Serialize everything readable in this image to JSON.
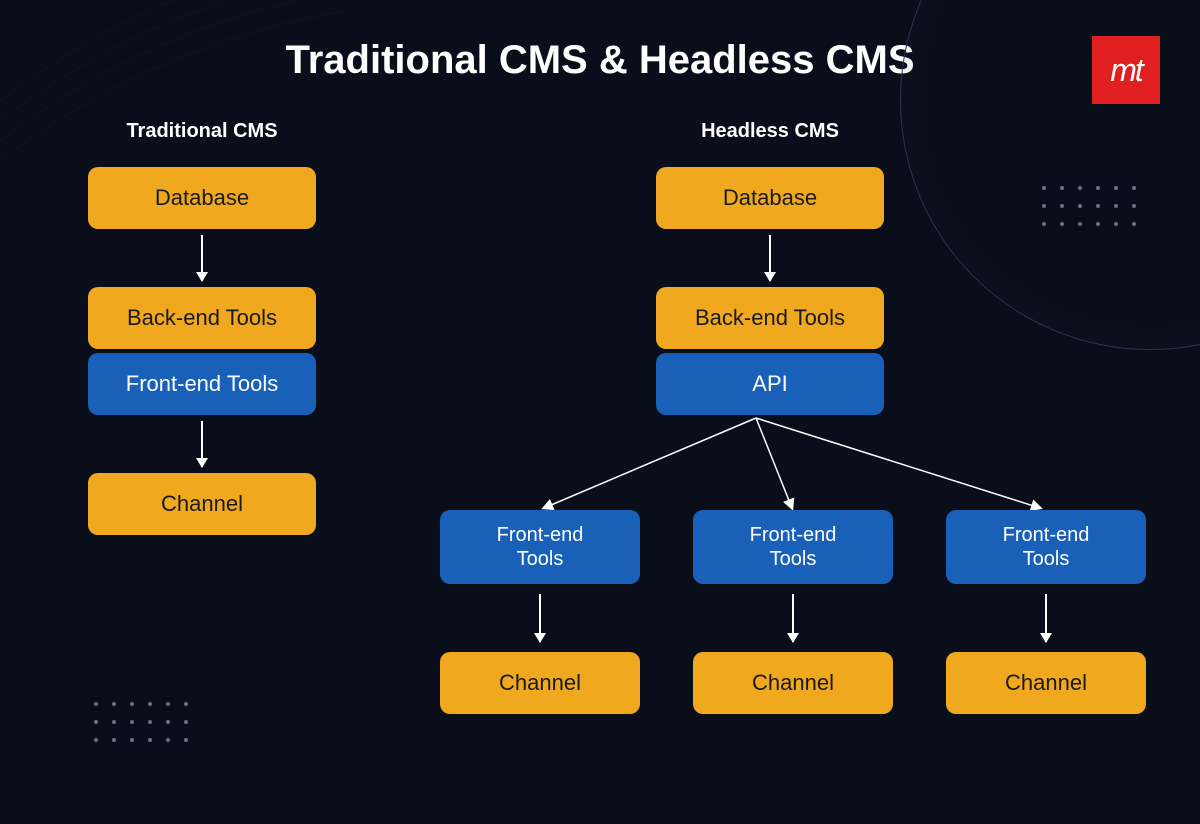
{
  "title": "Traditional CMS & Headless CMS",
  "logo": {
    "text": "mt"
  },
  "colors": {
    "orange": "#f0a81e",
    "blue": "#1860b8",
    "red": "#e02020",
    "bg": "#0a0e1a"
  },
  "traditional": {
    "title": "Traditional CMS",
    "database": "Database",
    "backend": "Back-end Tools",
    "frontend": "Front-end Tools",
    "channel": "Channel"
  },
  "headless": {
    "title": "Headless CMS",
    "database": "Database",
    "backend": "Back-end Tools",
    "api": "API",
    "branches": [
      {
        "frontend": "Front-end\nTools",
        "channel": "Channel"
      },
      {
        "frontend": "Front-end\nTools",
        "channel": "Channel"
      },
      {
        "frontend": "Front-end\nTools",
        "channel": "Channel"
      }
    ]
  }
}
